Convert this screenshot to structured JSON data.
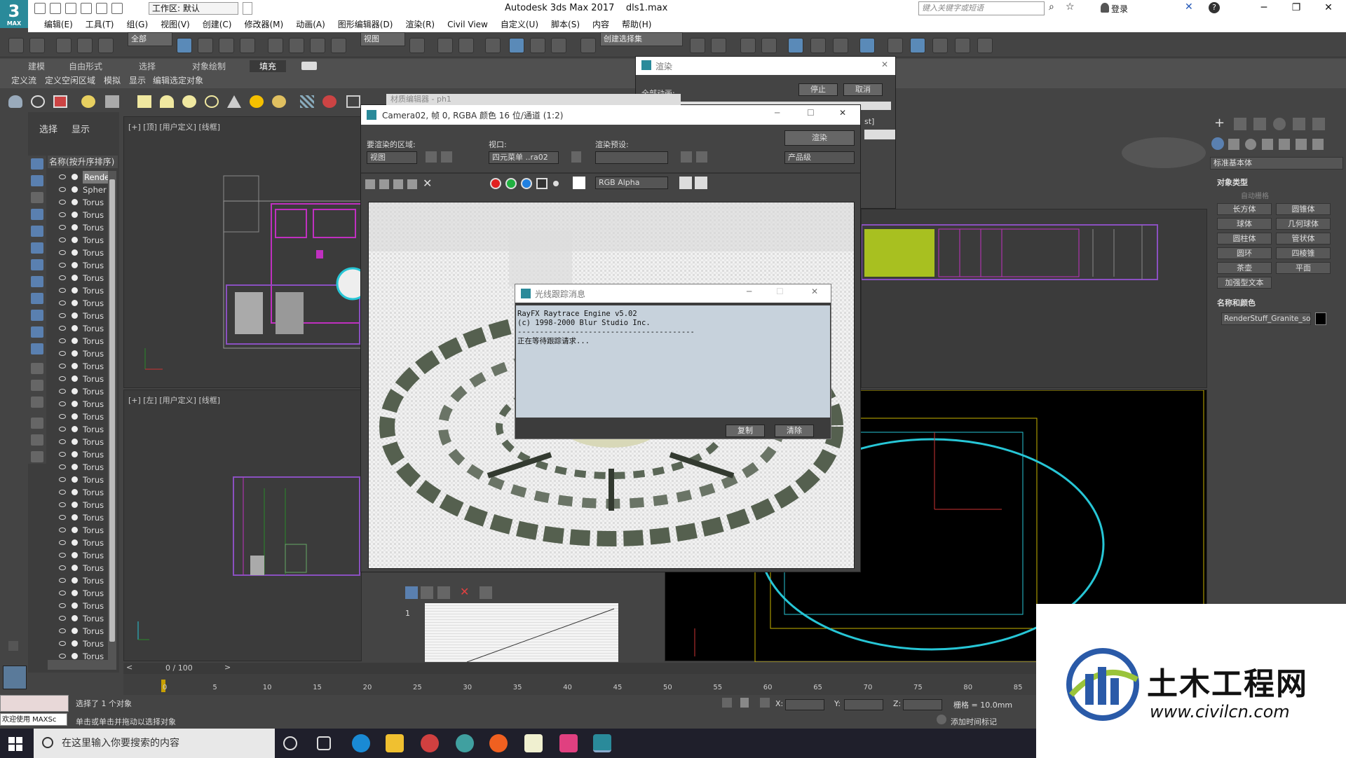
{
  "app": {
    "title": "Autodesk 3ds Max 2017",
    "file": "dls1.max",
    "workspace": "工作区: 默认",
    "search_placeholder": "键入关键字或短语",
    "login": "登录",
    "logo_text": "3",
    "logo_sub": "MAX"
  },
  "menu": [
    "编辑(E)",
    "工具(T)",
    "组(G)",
    "视图(V)",
    "创建(C)",
    "修改器(M)",
    "动画(A)",
    "图形编辑器(D)",
    "渲染(R)",
    "Civil View",
    "自定义(U)",
    "脚本(S)",
    "内容",
    "帮助(H)"
  ],
  "toolbar": {
    "filter": "全部",
    "refcoord": "视图",
    "selection_set": "创建选择集"
  },
  "ribbon": {
    "tabs": [
      "建模",
      "自由形式",
      "选择",
      "对象绘制",
      "填充"
    ],
    "active": "填充",
    "sub": [
      "定义流",
      "定义空闲区域",
      "模拟",
      "显示",
      "编辑选定对象"
    ]
  },
  "explorer": {
    "tabs": [
      "选择",
      "显示"
    ],
    "header": "名称(按升序排序)",
    "rows": [
      "RenderStuff",
      "Sphere",
      "Torus",
      "Torus",
      "Torus",
      "Torus",
      "Torus",
      "Torus",
      "Torus",
      "Torus",
      "Torus",
      "Torus",
      "Torus",
      "Torus",
      "Torus",
      "Torus",
      "Torus",
      "Torus",
      "Torus",
      "Torus",
      "Torus",
      "Torus",
      "Torus",
      "Torus",
      "Torus",
      "Torus",
      "Torus",
      "Torus",
      "Torus",
      "Torus",
      "Torus",
      "Torus",
      "Torus",
      "Torus",
      "Torus",
      "Torus",
      "Torus",
      "Torus",
      "Torus"
    ],
    "row_display": [
      "Rende",
      "Spher",
      "Torus"
    ]
  },
  "viewports": {
    "top": "[+] [顶] [用户定义] [线框]",
    "left": "[+] [左] [用户定义] [线框]"
  },
  "render_setup": {
    "title": "渲染",
    "label": "全部动画:",
    "stop": "停止",
    "cancel": "取消",
    "clipped": "st]"
  },
  "framebuffer": {
    "title": "Camera02, 帧 0, RGBA 颜色 16 位/通道 (1:2)",
    "behind_title": "材质编辑器 - ph1",
    "area_label": "要渲染的区域:",
    "area_value": "视图",
    "viewport_label": "视口:",
    "viewport_value": "四元菜单 ..ra02",
    "preset_label": "渲染预设:",
    "preset_value": "",
    "render_btn": "渲染",
    "quality": "产品级",
    "channel": "RGB Alpha"
  },
  "raytrace": {
    "title": "光线跟踪消息",
    "lines": [
      "RayFX Raytrace Engine v5.02",
      "(c) 1998-2000 Blur Studio Inc.",
      "----------------------------------------",
      "",
      "正在等待跟踪请求..."
    ],
    "copy": "复制",
    "clear": "清除"
  },
  "command_panel": {
    "dropdown": "标准基本体",
    "object_type": "对象类型",
    "autogrid": "自动栅格",
    "buttons": [
      "长方体",
      "圆锥体",
      "球体",
      "几何球体",
      "圆柱体",
      "管状体",
      "圆环",
      "四棱锥",
      "茶壶",
      "平面",
      "加强型文本"
    ],
    "name_color": "名称和颜色",
    "object_name": "RenderStuff_Granite_sock"
  },
  "timeline": {
    "frame": "0 / 100",
    "ticks": [
      "0",
      "5",
      "10",
      "15",
      "20",
      "25",
      "30",
      "35",
      "40",
      "45",
      "50",
      "55",
      "60",
      "65",
      "70",
      "75",
      "80",
      "85"
    ]
  },
  "status": {
    "selected": "选择了 1 个对象",
    "hint": "单击或单击并拖动以选择对象",
    "welcome": "欢迎使用 MAXSc",
    "x": "X:",
    "y": "Y:",
    "z": "Z:",
    "grid": "栅格 = 10.0mm",
    "add_tag": "添加时间标记"
  },
  "taskbar": {
    "search": "在这里输入你要搜索的内容"
  },
  "curve_editor": {
    "label": "1"
  },
  "watermark": {
    "title": "土木工程网",
    "url": "www.civilcn.com"
  },
  "colors": {
    "accent": "#5a8ab8",
    "cyan": "#27c6d6",
    "magenta": "#c030c0",
    "yellow": "#c8b400"
  }
}
